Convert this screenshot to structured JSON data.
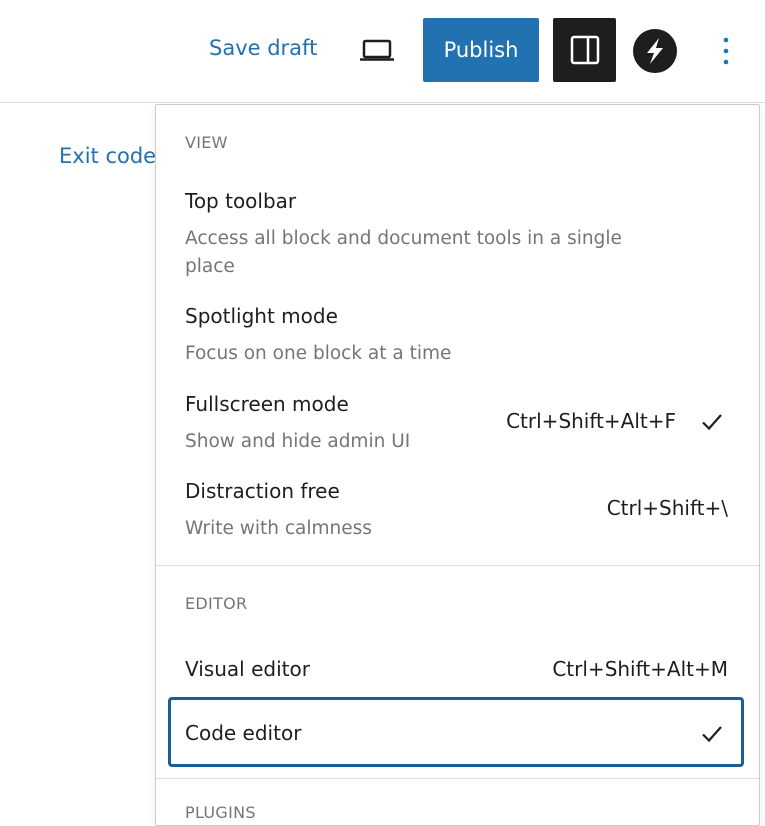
{
  "topbar": {
    "save_draft_label": "Save draft",
    "publish_label": "Publish",
    "preview_icon": "laptop-icon",
    "settings_icon": "sidebar-toggle-icon",
    "plugin_icon": "s-logo-icon",
    "options_icon": "more-vertical-icon"
  },
  "editor": {
    "exit_code_label": "Exit code"
  },
  "menu": {
    "view": {
      "label": "VIEW",
      "items": [
        {
          "label": "Top toolbar",
          "help": "Access all block and document tools in a single place",
          "shortcut": "",
          "checked": false
        },
        {
          "label": "Spotlight mode",
          "help": "Focus on one block at a time",
          "shortcut": "",
          "checked": false
        },
        {
          "label": "Fullscreen mode",
          "help": "Show and hide admin UI",
          "shortcut": "Ctrl+Shift+Alt+F",
          "checked": true
        },
        {
          "label": "Distraction free",
          "help": "Write with calmness",
          "shortcut": "Ctrl+Shift+\\",
          "checked": false
        }
      ]
    },
    "editor": {
      "label": "EDITOR",
      "items": [
        {
          "label": "Visual editor",
          "shortcut": "Ctrl+Shift+Alt+M",
          "checked": false
        },
        {
          "label": "Code editor",
          "shortcut": "",
          "checked": true,
          "focused": true
        }
      ]
    },
    "plugins": {
      "label": "PLUGINS"
    }
  },
  "colors": {
    "accent": "#2271b1",
    "dark": "#1e1e1e",
    "muted": "#757575",
    "focus": "#1a5e97"
  }
}
